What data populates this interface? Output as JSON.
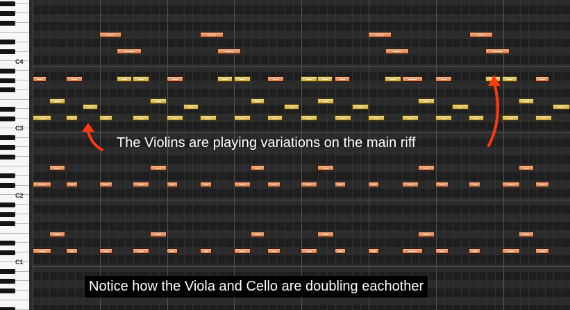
{
  "keyboard": {
    "octave_labels": [
      "C4",
      "C3",
      "C2",
      "C1"
    ]
  },
  "colors": {
    "grid_background": "#262626",
    "violin_note": "#e6cc6a",
    "viola_cello_note": "#ec9a6a",
    "annotation_arrow": "#ff3a10"
  },
  "annotations": {
    "violins": "The Violins are playing variations on the main riff",
    "viola_cello": "Notice how the Viola and Cello are doubling eachother"
  }
}
